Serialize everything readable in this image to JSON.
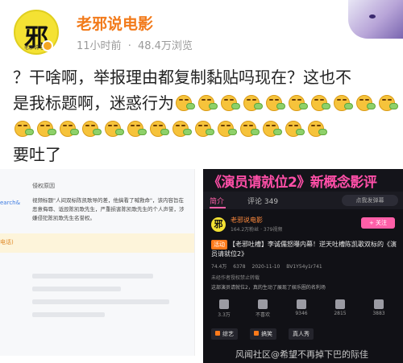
{
  "author": {
    "name": "老邪说电影",
    "avatar_char": "邪",
    "avatar_sub": "老邪说电影"
  },
  "meta": {
    "time": "11小时前",
    "separator": "·",
    "views": "48.4万浏览"
  },
  "post": {
    "line1_text": "？干啥啊，举报理由都复制黏贴吗现在？这也不",
    "line2_text": "是我标题啊，迷惑行为",
    "line2_emoji_count": 10,
    "line3_emoji_count": 14,
    "line4_text": "要吐了",
    "emoji_name": "vomit-emoji"
  },
  "left_screenshot": {
    "title": "侵权原因",
    "side_label": "earch&",
    "body": "视频标题\"人间双标陈凯歌导的差，他搞看了喊救命\"，该内容旨在恶意侮辱、诋毁陈凯歌先生，严重损害陈凯歌先生的个人声誉，涉嫌侵犯陈凯歌先生名誉权。",
    "yellow_label": "电话)"
  },
  "right_screenshot": {
    "banner": "《演员请就位2》新概念影评",
    "tabs": {
      "brief": "简介",
      "comments": "评论 349"
    },
    "danmaku": "点我发弹幕",
    "uploader": {
      "name": "老邪说电影",
      "fans": "164.2万粉丝 · 379视频",
      "follow": "+ 关注"
    },
    "title_tag": "活动",
    "title": "【老邪吐槽】李诚儒怒曝内幕！逆天吐槽陈凯歌双标的《演员请就位2》",
    "stats": [
      "74.4万",
      "6378",
      "2020-11-10",
      "BV1Y54y1r741"
    ],
    "warning": "未经作者授权禁止转载",
    "desc": "这部演员请就位2，真的生动了展现了娱乐圈的名利场",
    "actions": [
      "3.3万",
      "不喜欢",
      "9346",
      "2815",
      "3883"
    ],
    "chips": [
      "综艺",
      "搞笑",
      "真人秀"
    ]
  },
  "watermark": "风闻社区@希望不再掉下巴的际佳",
  "colors": {
    "username": "#f27a1a",
    "pink": "#ff5fa8",
    "gray_text": "#9a9a9a"
  }
}
